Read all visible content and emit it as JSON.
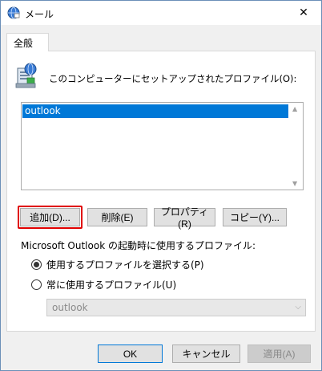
{
  "window": {
    "title": "メール",
    "close_glyph": "✕"
  },
  "tab": {
    "label": "全般"
  },
  "profiles": {
    "label": "このコンピューターにセットアップされたプロファイル(O):",
    "items": [
      "outlook"
    ],
    "selected_index": 0,
    "scroll_up": "▲",
    "scroll_down": "▼"
  },
  "buttons": {
    "add": "追加(D)...",
    "delete": "削除(E)",
    "properties": "プロパティ(R)",
    "copy": "コピー(Y)..."
  },
  "startup": {
    "label": "Microsoft Outlook の起動時に使用するプロファイル:",
    "option_choose": "使用するプロファイルを選択する(P)",
    "option_always": "常に使用するプロファイル(U)",
    "selected_option": "choose",
    "profile_select_value": "outlook",
    "select_chevron": "⌵"
  },
  "footer": {
    "ok": "OK",
    "cancel": "キャンセル",
    "apply": "適用(A)"
  },
  "colors": {
    "accent": "#0078d7",
    "highlight_border": "#e00000",
    "window_bg": "#f0f0f0"
  },
  "icons": {
    "title": "mail-globe-icon",
    "profiles": "mail-profile-icon",
    "close": "close-icon"
  }
}
